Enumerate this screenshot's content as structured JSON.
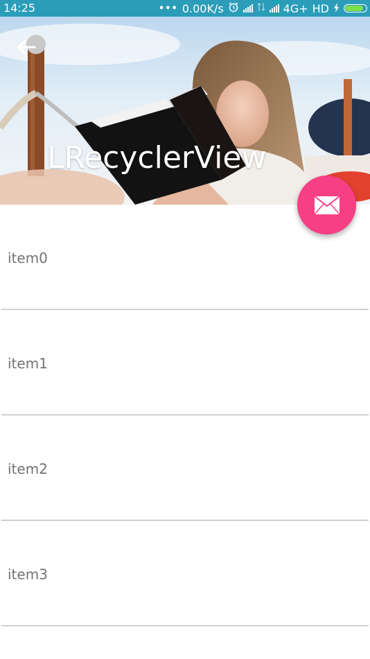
{
  "status_bar": {
    "time": "14:25",
    "dots": "•••",
    "net_speed": "0.00K/s",
    "network": "4G+",
    "hd": "HD"
  },
  "icons": {
    "back": "arrow-left-icon",
    "fab": "mail-icon",
    "alarm": "alarm-icon",
    "battery": "battery-icon",
    "charging": "lightning-icon"
  },
  "colors": {
    "status_bar": "#2b9db8",
    "fab": "#f73f84",
    "item_text": "#737373",
    "divider": "#cfcfcf"
  },
  "header": {
    "title": "LRecyclerView"
  },
  "list": {
    "items": [
      {
        "label": "item0"
      },
      {
        "label": "item1"
      },
      {
        "label": "item2"
      },
      {
        "label": "item3"
      }
    ]
  }
}
